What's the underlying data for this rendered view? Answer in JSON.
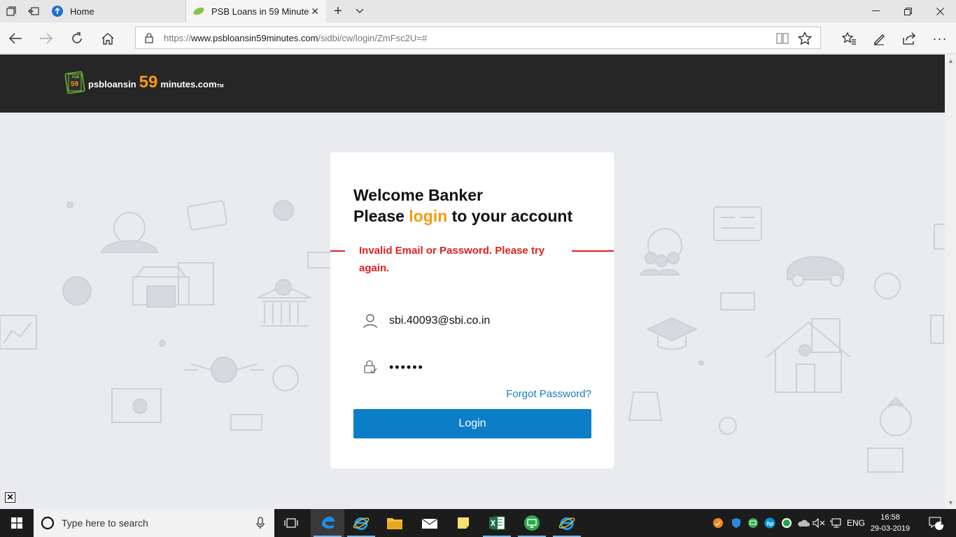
{
  "browser": {
    "tabs": [
      {
        "title": "Home"
      },
      {
        "title": "PSB Loans in 59 Minute"
      }
    ],
    "address": {
      "prefix": "https://",
      "host": "www.psbloansin59minutes.com",
      "path": "/sidbi/cw/login/ZmFsc2U=#"
    }
  },
  "site": {
    "logo": {
      "badge": "PSB",
      "badge_num": "59",
      "text_prefix": "psbloansin",
      "text_num": "59",
      "text_suffix": "minutes.com",
      "tm": "TM"
    }
  },
  "login": {
    "heading_line1": "Welcome Banker",
    "heading_line2_pre": "Please ",
    "heading_line2_accent": "login",
    "heading_line2_post": " to your account",
    "error": "Invalid Email or Password. Please try again.",
    "email_value": "sbi.40093@sbi.co.in",
    "password_value": "••••••",
    "forgot_label": "Forgot Password?",
    "button_label": "Login"
  },
  "taskbar": {
    "search_placeholder": "Type here to search",
    "language": "ENG",
    "time": "16:58",
    "date": "29-03-2019",
    "notification_count": "2"
  },
  "colors": {
    "accent": "#f59a0e",
    "error": "#e12020",
    "button": "#0b7ec7",
    "link": "#1a7cc2",
    "header": "#262626"
  }
}
